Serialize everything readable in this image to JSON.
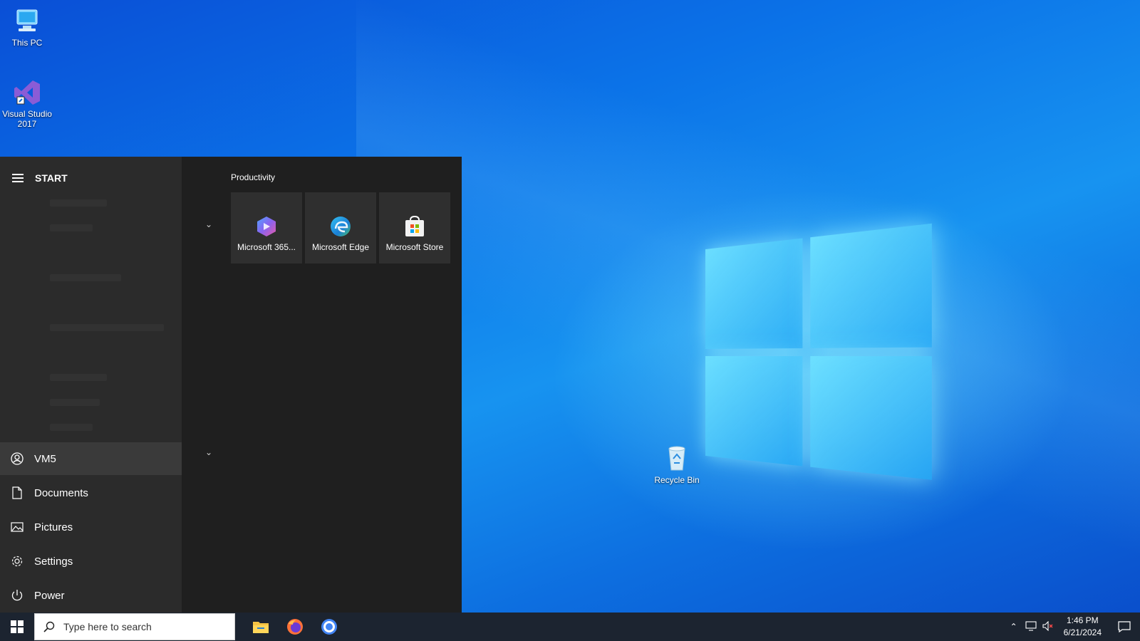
{
  "desktop": {
    "icons": [
      {
        "label": "This PC",
        "icon": "computer-icon"
      },
      {
        "label": "Visual Studio 2017",
        "icon": "visual-studio-icon"
      },
      {
        "label": "Recycle Bin",
        "icon": "recycle-bin-icon"
      }
    ]
  },
  "start_menu": {
    "title": "START",
    "user": {
      "name": "VM5",
      "icon": "user-avatar-icon"
    },
    "places": [
      {
        "label": "Documents",
        "icon": "document-icon"
      },
      {
        "label": "Pictures",
        "icon": "pictures-icon"
      },
      {
        "label": "Settings",
        "icon": "gear-icon"
      },
      {
        "label": "Power",
        "icon": "power-icon"
      }
    ],
    "group": {
      "title": "Productivity",
      "tiles": [
        {
          "label": "Microsoft 365...",
          "icon": "microsoft-365-icon"
        },
        {
          "label": "Microsoft Edge",
          "icon": "edge-icon"
        },
        {
          "label": "Microsoft Store",
          "icon": "store-icon"
        }
      ]
    }
  },
  "taskbar": {
    "search_placeholder": "Type here to search",
    "apps": [
      {
        "name": "File Explorer",
        "icon": "folder-icon"
      },
      {
        "name": "Firefox",
        "icon": "firefox-icon"
      },
      {
        "name": "Chrome",
        "icon": "chrome-icon"
      }
    ],
    "tray": {
      "time": "1:46 PM",
      "date": "6/21/2024"
    }
  },
  "colors": {
    "accent": "#0b73e8",
    "start_bg": "#1f1f1f",
    "rail_bg": "#2b2b2b"
  }
}
